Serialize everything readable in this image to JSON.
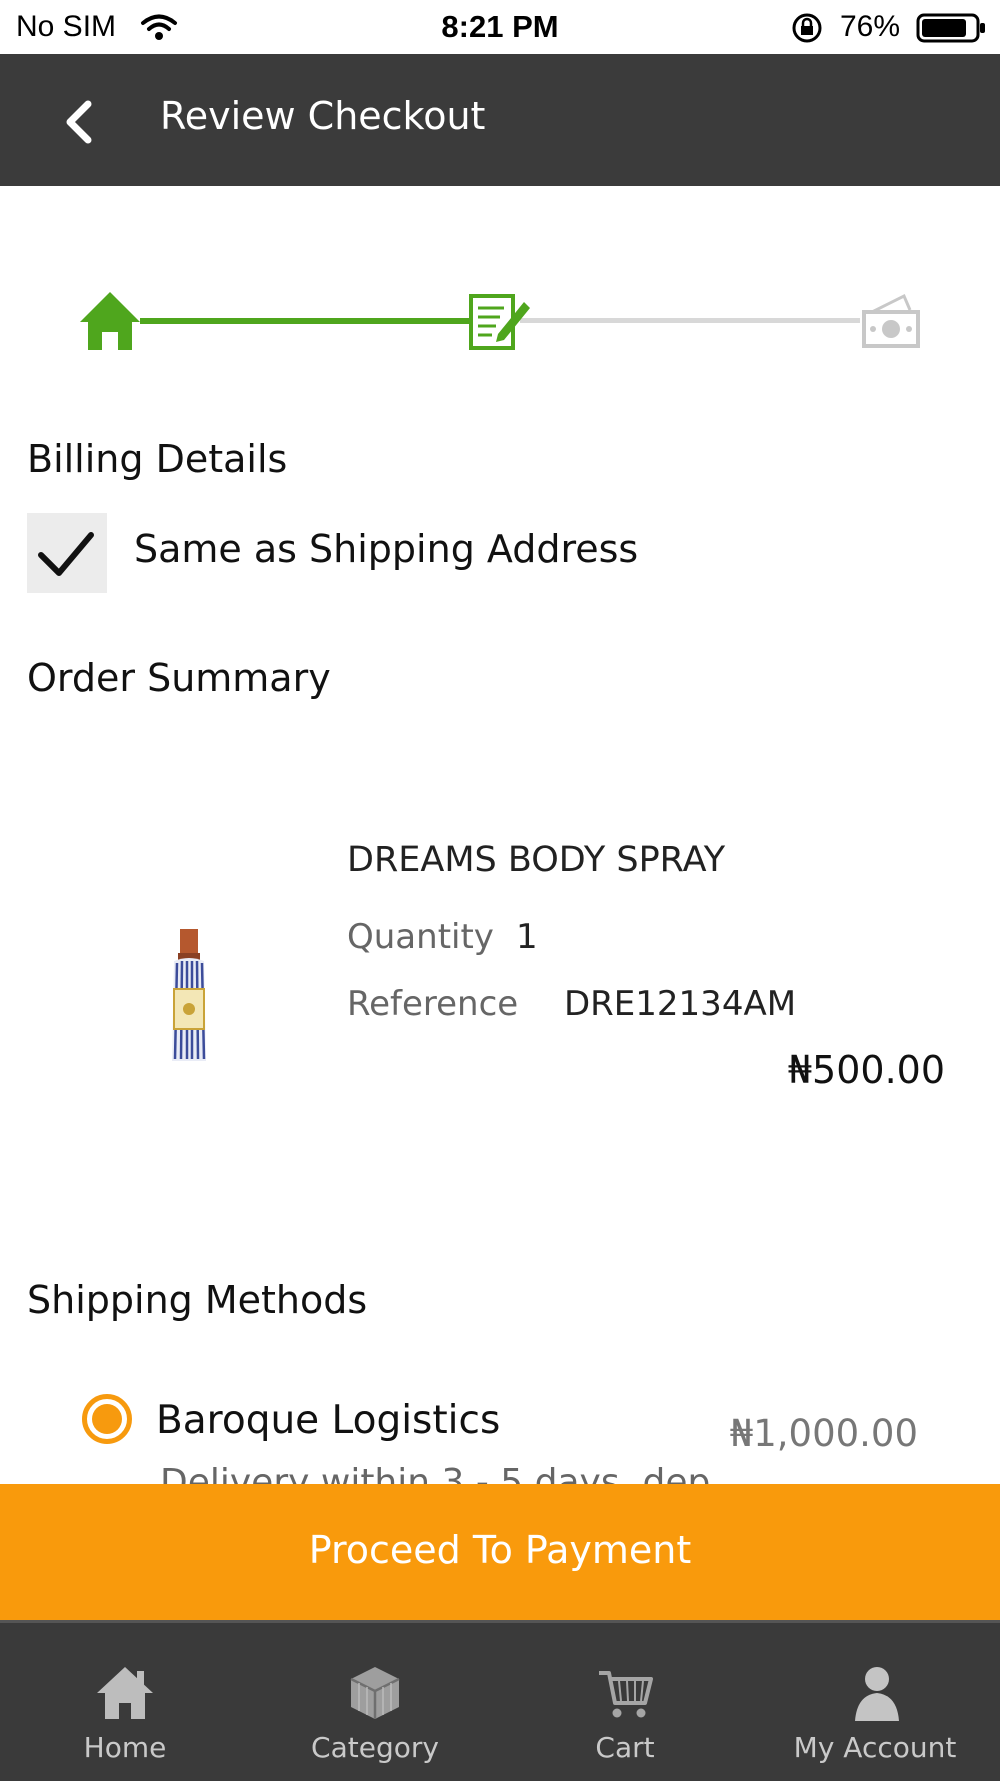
{
  "status_bar": {
    "carrier": "No SIM",
    "time": "8:21 PM",
    "battery": "76%"
  },
  "header": {
    "title": "Review Checkout",
    "background": "#3b3b3b"
  },
  "stepper": {
    "steps": [
      {
        "icon": "home-icon",
        "state": "done"
      },
      {
        "icon": "edit-icon",
        "state": "current"
      },
      {
        "icon": "money-icon",
        "state": "pending"
      }
    ],
    "active_color": "#4fa61d",
    "inactive_color": "#d8d8d8"
  },
  "billing": {
    "title": "Billing Details",
    "same_as_shipping_label": "Same as Shipping Address",
    "same_as_shipping_checked": true
  },
  "order_summary": {
    "title": "Order Summary",
    "item": {
      "name": "DREAMS BODY SPRAY",
      "quantity_label": "Quantity",
      "quantity": "1",
      "reference_label": "Reference",
      "reference": "DRE12134AM",
      "price": "₦500.00"
    }
  },
  "shipping": {
    "title": "Shipping Methods",
    "method": {
      "name": "Baroque Logistics",
      "price": "₦1,000.00",
      "description": "Delivery within 3 - 5 days, dep",
      "selected": true
    }
  },
  "actions": {
    "proceed_label": "Proceed To Payment",
    "accent": "#f99a0c"
  },
  "tab_bar": {
    "tabs": [
      {
        "label": "Home",
        "icon": "home-icon"
      },
      {
        "label": "Category",
        "icon": "cube-icon"
      },
      {
        "label": "Cart",
        "icon": "cart-icon"
      },
      {
        "label": "My Account",
        "icon": "user-icon"
      }
    ]
  }
}
